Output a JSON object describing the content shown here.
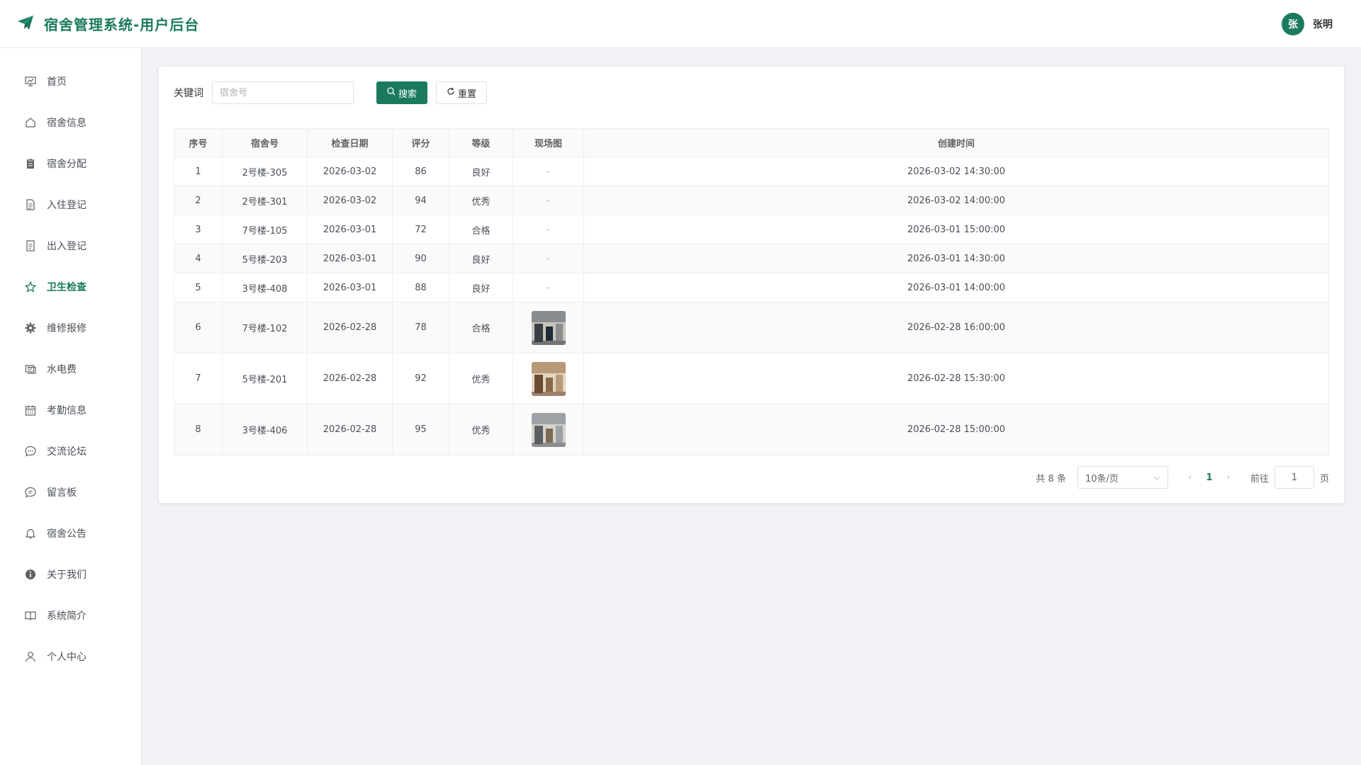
{
  "header": {
    "title": "宿舍管理系统-用户后台",
    "avatar_text": "张",
    "username": "张明"
  },
  "sidebar": {
    "items": [
      {
        "label": "首页",
        "icon": "chart-board-icon"
      },
      {
        "label": "宿舍信息",
        "icon": "house-icon"
      },
      {
        "label": "宿舍分配",
        "icon": "clipboard-icon"
      },
      {
        "label": "入住登记",
        "icon": "document-icon"
      },
      {
        "label": "出入登记",
        "icon": "tickets-icon"
      },
      {
        "label": "卫生检查",
        "icon": "star-icon"
      },
      {
        "label": "维修报修",
        "icon": "gear-icon"
      },
      {
        "label": "水电费",
        "icon": "money-icon"
      },
      {
        "label": "考勤信息",
        "icon": "calendar-icon"
      },
      {
        "label": "交流论坛",
        "icon": "chat-dots-icon"
      },
      {
        "label": "留言板",
        "icon": "chat-line-icon"
      },
      {
        "label": "宿舍公告",
        "icon": "bell-icon"
      },
      {
        "label": "关于我们",
        "icon": "info-icon"
      },
      {
        "label": "系统简介",
        "icon": "book-icon"
      },
      {
        "label": "个人中心",
        "icon": "user-icon"
      }
    ],
    "active_index": 5
  },
  "search": {
    "label": "关键词",
    "placeholder": "宿舍号",
    "value": "",
    "search_button": "搜索",
    "reset_button": "重置"
  },
  "table": {
    "columns": [
      "序号",
      "宿舍号",
      "检查日期",
      "评分",
      "等级",
      "现场图",
      "创建时间"
    ],
    "rows": [
      {
        "no": "1",
        "room": "2号楼-305",
        "date": "2026-03-02",
        "score": "86",
        "level": "良好",
        "photo": "-",
        "created": "2026-03-02 14:30:00"
      },
      {
        "no": "2",
        "room": "2号楼-301",
        "date": "2026-03-02",
        "score": "94",
        "level": "优秀",
        "photo": "-",
        "created": "2026-03-02 14:00:00"
      },
      {
        "no": "3",
        "room": "7号楼-105",
        "date": "2026-03-01",
        "score": "72",
        "level": "合格",
        "photo": "-",
        "created": "2026-03-01 15:00:00"
      },
      {
        "no": "4",
        "room": "5号楼-203",
        "date": "2026-03-01",
        "score": "90",
        "level": "良好",
        "photo": "-",
        "created": "2026-03-01 14:30:00"
      },
      {
        "no": "5",
        "room": "3号楼-408",
        "date": "2026-03-01",
        "score": "88",
        "level": "良好",
        "photo": "-",
        "created": "2026-03-01 14:00:00"
      },
      {
        "no": "6",
        "room": "7号楼-102",
        "date": "2026-02-28",
        "score": "78",
        "level": "合格",
        "photo": "image",
        "created": "2026-02-28 16:00:00"
      },
      {
        "no": "7",
        "room": "5号楼-201",
        "date": "2026-02-28",
        "score": "92",
        "level": "优秀",
        "photo": "image",
        "created": "2026-02-28 15:30:00"
      },
      {
        "no": "8",
        "room": "3号楼-406",
        "date": "2026-02-28",
        "score": "95",
        "level": "优秀",
        "photo": "image",
        "created": "2026-02-28 15:00:00"
      }
    ]
  },
  "pagination": {
    "total_text": "共 8 条",
    "page_size": "10条/页",
    "current_page": "1",
    "goto_label": "前往",
    "goto_value": "1",
    "page_suffix": "页"
  },
  "colors": {
    "accent": "#1b7a5e",
    "background": "#f0f2f5"
  }
}
